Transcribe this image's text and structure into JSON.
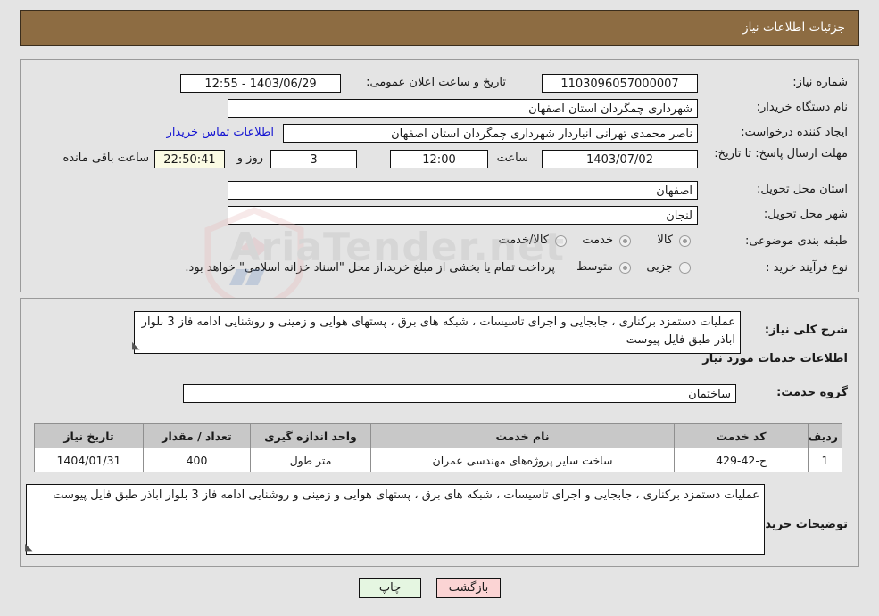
{
  "header": {
    "title": "جزئیات اطلاعات نیاز"
  },
  "watermark": {
    "text": "AriaTender.net"
  },
  "top_section": {
    "need_number": {
      "label": "شماره نیاز:",
      "value": "1103096057000007"
    },
    "public_announce": {
      "label": "تاریخ و ساعت اعلان عمومی:",
      "value": "1403/06/29 - 12:55"
    },
    "buyer_org": {
      "label": "نام دستگاه خریدار:",
      "value": "شهرداری چمگردان استان اصفهان"
    },
    "request_creator": {
      "label": "ایجاد کننده درخواست:",
      "value": "ناصر محمدی تهرانی انباردار شهرداری چمگردان استان اصفهان"
    },
    "buyer_contact_link": "اطلاعات تماس خریدار",
    "deadline": {
      "label": "مهلت ارسال پاسخ: تا تاریخ:",
      "date": "1403/07/02",
      "time_label": "ساعت",
      "time": "12:00",
      "days": "3",
      "days_label": "روز و",
      "timer": "22:50:41",
      "timer_label": "ساعت باقی مانده"
    },
    "delivery_province": {
      "label": "استان محل تحویل:",
      "value": "اصفهان"
    },
    "delivery_city": {
      "label": "شهر محل تحویل:",
      "value": "لنجان"
    },
    "subject_category": {
      "label": "طبقه بندی موضوعی:",
      "options": [
        {
          "label": "کالا",
          "selected": false
        },
        {
          "label": "خدمت",
          "selected": true
        },
        {
          "label": "کالا/خدمت",
          "selected": false
        }
      ]
    },
    "purchase_process": {
      "label": "نوع فرآیند خرید :",
      "options": [
        {
          "label": "جزیی",
          "selected": false
        },
        {
          "label": "متوسط",
          "selected": true
        }
      ],
      "note": "پرداخت تمام یا بخشی از مبلغ خرید،از محل \"اسناد خزانه اسلامی\" خواهد بود."
    }
  },
  "bottom_section": {
    "general_description": {
      "label": "شرح کلی نیاز:",
      "value": "عملیات دستمزد برکناری ، جابجایی و اجرای تاسیسات ، شبکه های برق ، پستهای هوایی و زمینی و روشنایی ادامه فاز 3 بلوار اباذر طبق فایل پیوست"
    },
    "services_heading": "اطلاعات خدمات مورد نیاز",
    "service_group": {
      "label": "گروه خدمت:",
      "value": "ساختمان"
    },
    "table": {
      "headers": [
        "ردیف",
        "کد خدمت",
        "نام خدمت",
        "واحد اندازه گیری",
        "تعداد / مقدار",
        "تاریخ نیاز"
      ],
      "rows": [
        {
          "row": "1",
          "code": "ج-42-429",
          "name": "ساخت سایر پروژه‌های مهندسی عمران",
          "unit": "متر طول",
          "quantity": "400",
          "need_date": "1404/01/31"
        }
      ]
    },
    "buyer_notes": {
      "label": "توضیحات خریدار:",
      "value": "عملیات دستمزد برکناری ، جابجایی و اجرای تاسیسات ، شبکه های برق ، پستهای هوایی و زمینی و روشنایی ادامه فاز 3 بلوار اباذر طبق فایل پیوست"
    }
  },
  "footer": {
    "print_label": "چاپ",
    "back_label": "بازگشت"
  }
}
